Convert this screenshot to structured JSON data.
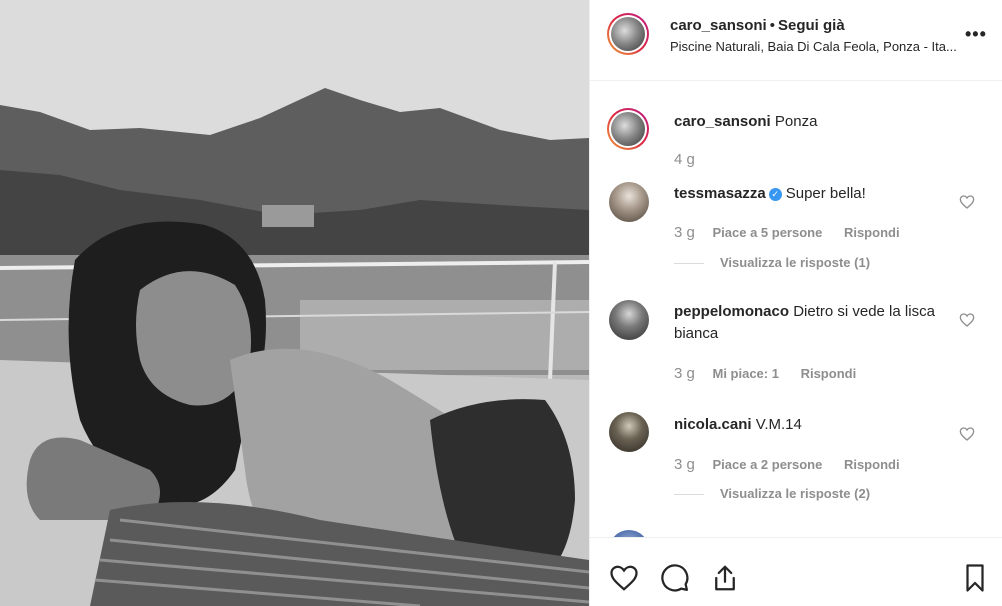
{
  "post": {
    "header": {
      "username": "caro_sansoni",
      "separator": "•",
      "follow_status": "Segui già",
      "location": "Piscine Naturali, Baia Di Cala Feola, Ponza - Ita...",
      "more_icon": "more-dots-icon"
    },
    "caption": {
      "username": "caro_sansoni",
      "text": "Ponza",
      "time": "4 g"
    },
    "comments": [
      {
        "username": "tessmasazza",
        "verified": true,
        "text": "Super bella!",
        "time": "3 g",
        "likes": "Piace a 5 persone",
        "reply": "Rispondi",
        "view_replies": "Visualizza le risposte (1)"
      },
      {
        "username": "peppelomonaco",
        "verified": false,
        "text": "Dietro si vede la lisca bianca",
        "time": "3 g",
        "likes": "Mi piace: 1",
        "reply": "Rispondi"
      },
      {
        "username": "nicola.cani",
        "verified": false,
        "text": "V.M.14",
        "time": "3 g",
        "likes": "Piace a 2 persone",
        "reply": "Rispondi",
        "view_replies": "Visualizza le risposte (2)"
      }
    ],
    "actions": {
      "icons": [
        "heart-icon",
        "comment-icon",
        "share-icon",
        "bookmark-icon"
      ]
    }
  },
  "colors": {
    "text": "#262626",
    "secondary": "#8e8e8e",
    "verified": "#3897f0",
    "border": "#efefef"
  }
}
